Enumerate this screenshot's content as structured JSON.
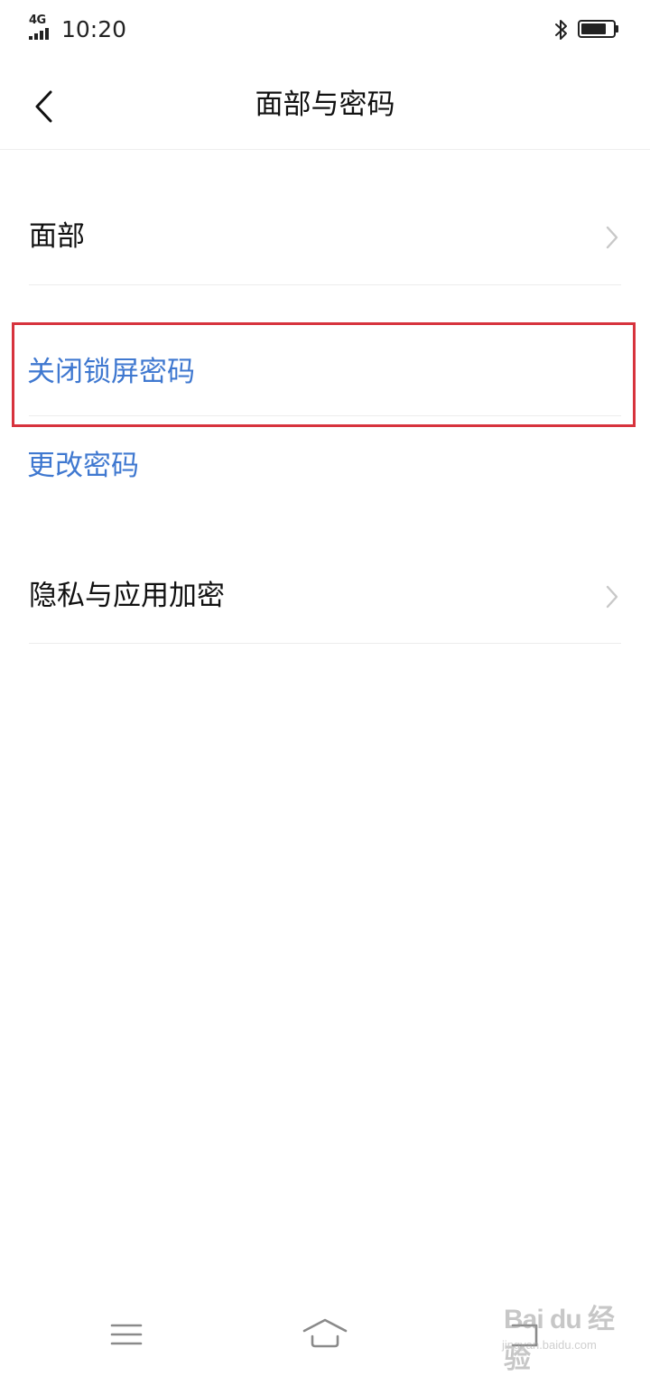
{
  "status_bar": {
    "network": "4G",
    "time": "10:20",
    "icons": [
      "signal-icon",
      "bluetooth-icon",
      "battery-icon"
    ]
  },
  "header": {
    "title": "面部与密码",
    "back_icon": "chevron-left-icon"
  },
  "items": [
    {
      "label": "面部",
      "style": "normal",
      "chevron": true
    },
    {
      "label": "关闭锁屏密码",
      "style": "link",
      "chevron": false,
      "highlighted": true
    },
    {
      "label": "更改密码",
      "style": "link",
      "chevron": false
    },
    {
      "label": "隐私与应用加密",
      "style": "normal",
      "chevron": true
    }
  ],
  "nav": {
    "icons": [
      "menu-icon",
      "home-icon",
      "back-return-icon"
    ]
  },
  "watermark": {
    "main": "Bai du 经验",
    "sub": "jingyan.baidu.com"
  },
  "colors": {
    "link": "#3f78d0",
    "highlight_border": "#d7333d",
    "divider": "#ececec"
  }
}
